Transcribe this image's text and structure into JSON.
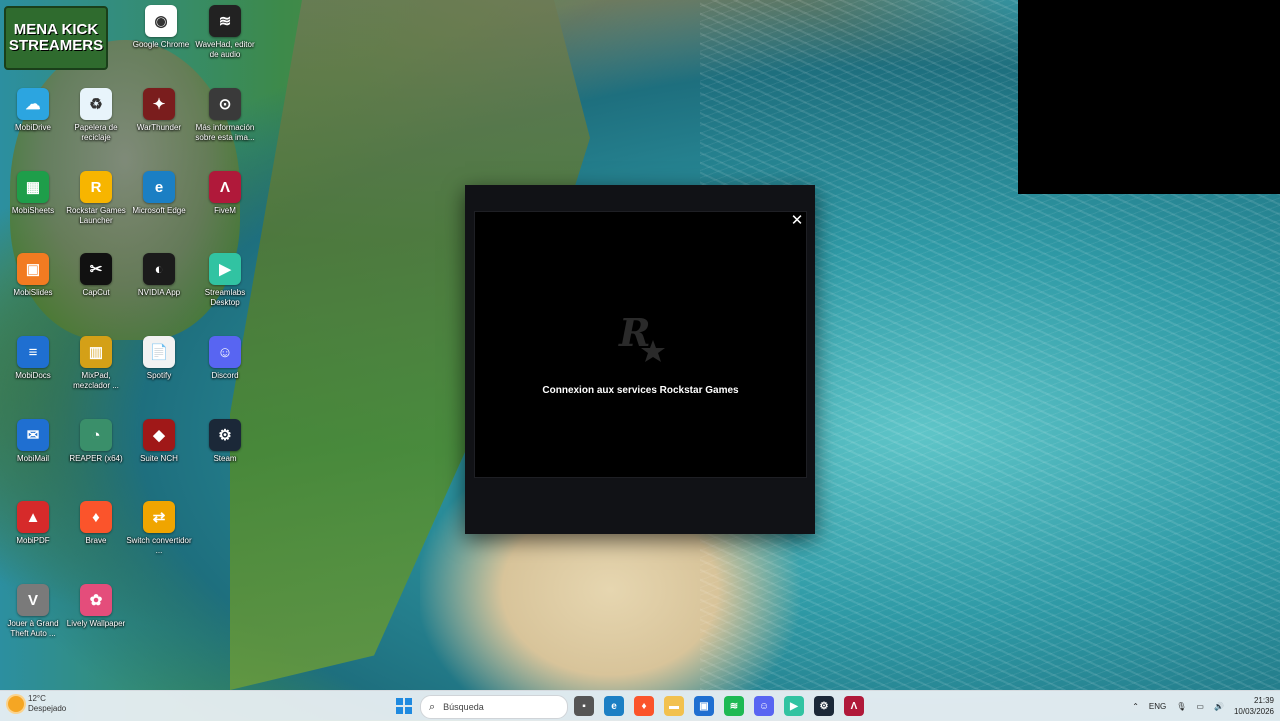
{
  "logo": {
    "line1": "MENA KICK",
    "line2": "STREAMERS"
  },
  "desktop_icons": [
    {
      "label": "Google Chrome",
      "icon": "chrome-icon",
      "color": "#ffffff",
      "glyph": "◉"
    },
    {
      "label": "WaveHad, editor de audio",
      "icon": "wavepad-icon",
      "color": "#222222",
      "glyph": "≋"
    },
    {
      "label": "MobiDrive",
      "icon": "mobidrive-icon",
      "color": "#2ca5e0",
      "glyph": "☁"
    },
    {
      "label": "Papelera de reciclaje",
      "icon": "recycle-bin-icon",
      "color": "#e8f4fb",
      "glyph": "♻"
    },
    {
      "label": "WarThunder",
      "icon": "warthunder-icon",
      "color": "#7a1d1d",
      "glyph": "✦"
    },
    {
      "label": "Más información sobre esta ima...",
      "icon": "info-icon",
      "color": "#3a3a3a",
      "glyph": "⊙"
    },
    {
      "label": "MobiSheets",
      "icon": "mobisheets-icon",
      "color": "#1e9e4a",
      "glyph": "▦"
    },
    {
      "label": "Rockstar Games Launcher",
      "icon": "rockstar-icon",
      "color": "#f7b500",
      "glyph": "R"
    },
    {
      "label": "Microsoft Edge",
      "icon": "edge-icon",
      "color": "#1b7fc4",
      "glyph": "e"
    },
    {
      "label": "FiveM",
      "icon": "fivem-icon",
      "color": "#b0193a",
      "glyph": "Λ"
    },
    {
      "label": "MobiSlides",
      "icon": "mobislides-icon",
      "color": "#f27b21",
      "glyph": "▣"
    },
    {
      "label": "CapCut",
      "icon": "capcut-icon",
      "color": "#111111",
      "glyph": "✂"
    },
    {
      "label": "NVIDIA App",
      "icon": "nvidia-icon",
      "color": "#1b1b1b",
      "glyph": "◐"
    },
    {
      "label": "Streamlabs Desktop",
      "icon": "streamlabs-icon",
      "color": "#31c3a2",
      "glyph": "▶"
    },
    {
      "label": "MobiDocs",
      "icon": "mobidocs-icon",
      "color": "#1f6fd1",
      "glyph": "≡"
    },
    {
      "label": "MixPad, mezclador ...",
      "icon": "mixpad-icon",
      "color": "#d4a017",
      "glyph": "▥"
    },
    {
      "label": "Spotify",
      "icon": "spotify-file-icon",
      "color": "#f2f2f2",
      "glyph": "📄"
    },
    {
      "label": "Discord",
      "icon": "discord-icon",
      "color": "#5865f2",
      "glyph": "☺"
    },
    {
      "label": "MobiMail",
      "icon": "mobimail-icon",
      "color": "#1f6fd1",
      "glyph": "✉"
    },
    {
      "label": "REAPER (x64)",
      "icon": "reaper-icon",
      "color": "#3a8f6a",
      "glyph": "◔"
    },
    {
      "label": "Suite NCH",
      "icon": "nch-suite-icon",
      "color": "#a01818",
      "glyph": "◆"
    },
    {
      "label": "Steam",
      "icon": "steam-icon",
      "color": "#1b2838",
      "glyph": "⚙"
    },
    {
      "label": "MobiPDF",
      "icon": "mobipdf-icon",
      "color": "#d62a2a",
      "glyph": "▲"
    },
    {
      "label": "Brave",
      "icon": "brave-icon",
      "color": "#fb542b",
      "glyph": "♦"
    },
    {
      "label": "Switch convertidor ...",
      "icon": "switch-converter-icon",
      "color": "#f0a500",
      "glyph": "⇄"
    },
    {
      "label": "Jouer à Grand Theft Auto ...",
      "icon": "gta-icon",
      "color": "#7a7a7a",
      "glyph": "V"
    },
    {
      "label": "Lively Wallpaper",
      "icon": "lively-icon",
      "color": "#e44d7b",
      "glyph": "✿"
    }
  ],
  "dialog": {
    "message": "Connexion aux services Rockstar Games",
    "close_glyph": "✕"
  },
  "taskbar": {
    "weather_temp": "12°C",
    "weather_desc": "Despejado",
    "search_placeholder": "Búsqueda",
    "language": "ENG",
    "time": "21:39",
    "date": "10/03/2026",
    "apps": [
      {
        "name": "file-explorer-task-icon",
        "color": "#555555",
        "glyph": "▪"
      },
      {
        "name": "edge-task-icon",
        "color": "#1b7fc4",
        "glyph": "e"
      },
      {
        "name": "brave-task-icon",
        "color": "#fb542b",
        "glyph": "♦"
      },
      {
        "name": "folder-task-icon",
        "color": "#f2c14e",
        "glyph": "▬"
      },
      {
        "name": "store-task-icon",
        "color": "#1f6fd1",
        "glyph": "▣"
      },
      {
        "name": "spotify-task-icon",
        "color": "#1db954",
        "glyph": "≋"
      },
      {
        "name": "discord-task-icon",
        "color": "#5865f2",
        "glyph": "☺"
      },
      {
        "name": "streamlabs-task-icon",
        "color": "#31c3a2",
        "glyph": "▶"
      },
      {
        "name": "steam-task-icon",
        "color": "#1b2838",
        "glyph": "⚙"
      },
      {
        "name": "fivem-task-icon",
        "color": "#b0193a",
        "glyph": "Λ"
      }
    ]
  }
}
